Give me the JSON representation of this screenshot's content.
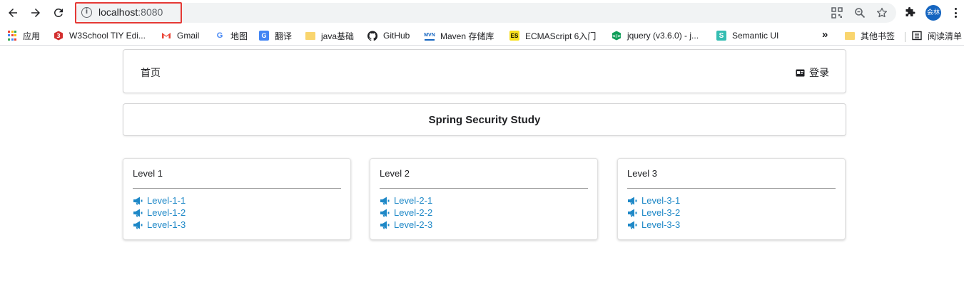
{
  "browser": {
    "url_host": "localhost",
    "url_port": ":8080",
    "profile_initials": "会林"
  },
  "bookmarks": {
    "apps_label": "应用",
    "items": [
      {
        "label": "W3School TIY Edi...",
        "icon": "w3school-icon"
      },
      {
        "label": "Gmail",
        "icon": "gmail-icon"
      },
      {
        "label": "地图",
        "icon": "google-icon"
      },
      {
        "label": "翻译",
        "icon": "translate-icon"
      },
      {
        "label": "java基础",
        "icon": "folder-icon"
      },
      {
        "label": "GitHub",
        "icon": "github-icon"
      },
      {
        "label": "Maven 存储库",
        "icon": "maven-icon"
      },
      {
        "label": "ECMAScript 6入门",
        "icon": "es-icon"
      },
      {
        "label": "jquery (v3.6.0) - j...",
        "icon": "jquery-icon"
      },
      {
        "label": "Semantic UI",
        "icon": "semantic-icon"
      }
    ],
    "other_bookmarks": "其他书签",
    "reading_list": "阅读清单"
  },
  "page": {
    "menu": {
      "home": "首页",
      "login": "登录"
    },
    "title": "Spring Security Study",
    "levels": [
      {
        "heading": "Level 1",
        "links": [
          "Level-1-1",
          "Level-1-2",
          "Level-1-3"
        ]
      },
      {
        "heading": "Level 2",
        "links": [
          "Level-2-1",
          "Level-2-2",
          "Level-2-3"
        ]
      },
      {
        "heading": "Level 3",
        "links": [
          "Level-3-1",
          "Level-3-2",
          "Level-3-3"
        ]
      }
    ]
  },
  "colors": {
    "link": "#1e88c7",
    "url_highlight": "#e53935",
    "avatar": "#1565c0"
  }
}
